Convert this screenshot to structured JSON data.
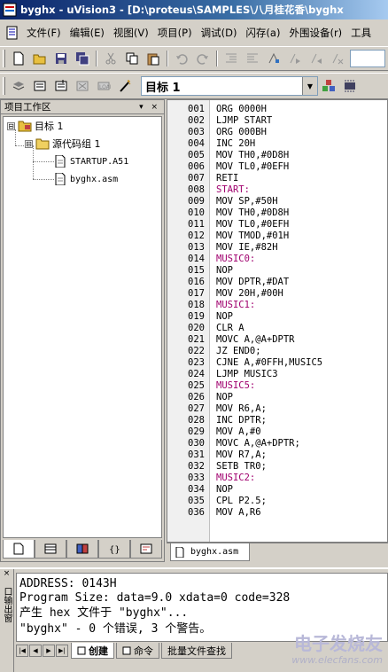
{
  "window": {
    "title": "byghx - uVision3 - [D:\\proteus\\SAMPLES\\八月桂花香\\byghx"
  },
  "menu": [
    "文件(F)",
    "编辑(E)",
    "视图(V)",
    "项目(P)",
    "调试(D)",
    "闪存(a)",
    "外围设备(r)",
    "工具"
  ],
  "toolbar": {
    "target_value": "目标 1"
  },
  "project_pane": {
    "title": "项目工作区",
    "controls": "▾ ×",
    "tree": [
      {
        "label": "目标 1",
        "level": 0,
        "kind": "target",
        "expander": "⊟"
      },
      {
        "label": "源代码组 1",
        "level": 1,
        "kind": "folder",
        "expander": "⊟"
      },
      {
        "label": "STARTUP.A51",
        "level": 2,
        "kind": "file"
      },
      {
        "label": "byghx.asm",
        "level": 2,
        "kind": "file"
      }
    ]
  },
  "editor": {
    "tab_label": "byghx.asm",
    "lines": [
      {
        "n": "001",
        "code": "ORG 0000H"
      },
      {
        "n": "002",
        "code": "LJMP START"
      },
      {
        "n": "003",
        "code": "ORG 000BH"
      },
      {
        "n": "004",
        "code": "INC 20H"
      },
      {
        "n": "005",
        "code": "MOV TH0,#0D8H"
      },
      {
        "n": "006",
        "code": "MOV TL0,#0EFH"
      },
      {
        "n": "007",
        "code": "RETI"
      },
      {
        "n": "008",
        "code": "START:",
        "label": true
      },
      {
        "n": "009",
        "code": "MOV SP,#50H"
      },
      {
        "n": "010",
        "code": "MOV TH0,#0D8H"
      },
      {
        "n": "011",
        "code": "MOV TL0,#0EFH"
      },
      {
        "n": "012",
        "code": "MOV TMOD,#01H"
      },
      {
        "n": "013",
        "code": "MOV IE,#82H"
      },
      {
        "n": "014",
        "code": "MUSIC0:",
        "label": true
      },
      {
        "n": "015",
        "code": "NOP"
      },
      {
        "n": "016",
        "code": "MOV DPTR,#DAT"
      },
      {
        "n": "017",
        "code": "MOV 20H,#00H"
      },
      {
        "n": "018",
        "code": "MUSIC1:",
        "label": true
      },
      {
        "n": "019",
        "code": "NOP"
      },
      {
        "n": "020",
        "code": "CLR A"
      },
      {
        "n": "021",
        "code": "MOVC A,@A+DPTR"
      },
      {
        "n": "022",
        "code": "JZ END0;"
      },
      {
        "n": "023",
        "code": "CJNE A,#0FFH,MUSIC5"
      },
      {
        "n": "024",
        "code": "LJMP MUSIC3"
      },
      {
        "n": "025",
        "code": "MUSIC5:",
        "label": true
      },
      {
        "n": "026",
        "code": "NOP"
      },
      {
        "n": "027",
        "code": "MOV R6,A;"
      },
      {
        "n": "028",
        "code": "INC DPTR;"
      },
      {
        "n": "029",
        "code": "MOV A,#0"
      },
      {
        "n": "030",
        "code": "MOVC A,@A+DPTR;"
      },
      {
        "n": "031",
        "code": "MOV R7,A;"
      },
      {
        "n": "032",
        "code": "SETB TR0;"
      },
      {
        "n": "033",
        "code": "MUSIC2:",
        "label": true
      },
      {
        "n": "034",
        "code": "NOP"
      },
      {
        "n": "035",
        "code": "CPL P2.5;"
      },
      {
        "n": "036",
        "code": "MOV A,R6"
      }
    ]
  },
  "output": {
    "side_label": "口输出窗",
    "lines": [
      "    ADDRESS: 0143H",
      "Program Size: data=9.0 xdata=0 code=328",
      "产生 hex 文件于 \"byghx\"...",
      "\"byghx\" - 0 个错误, 3 个警告。"
    ],
    "tabs": [
      "创建",
      "命令",
      "批量文件查找"
    ]
  },
  "watermark": {
    "brand": "电子发烧友",
    "url": "www.elecfans.com"
  },
  "colors": {
    "title_start": "#0a246a",
    "title_end": "#a6caf0",
    "label_code": "#a0006e",
    "chrome": "#d4d0c8"
  }
}
